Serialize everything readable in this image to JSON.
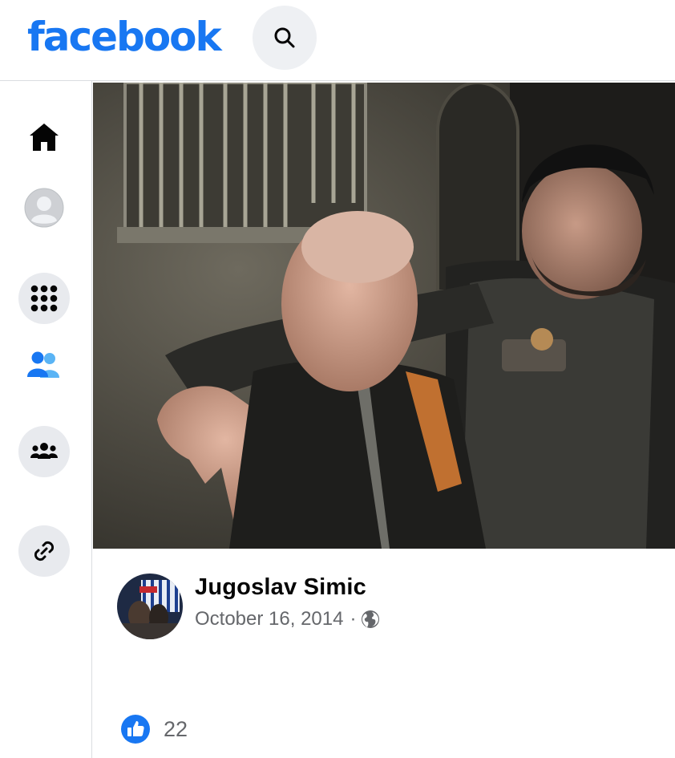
{
  "brand": {
    "name": "facebook",
    "color": "#1877f2"
  },
  "header": {
    "search_icon": "search-icon"
  },
  "sidebar": {
    "items": [
      {
        "icon": "home-icon"
      },
      {
        "icon": "profile-avatar-icon"
      },
      {
        "icon": "apps-grid-icon"
      },
      {
        "icon": "friends-icon"
      },
      {
        "icon": "groups-icon"
      },
      {
        "icon": "link-icon"
      }
    ]
  },
  "post": {
    "author": "Jugoslav Simic",
    "date": "October 16, 2014",
    "separator": "·",
    "privacy_icon": "globe-icon",
    "reaction_icon": "like-icon",
    "likes": "22"
  }
}
